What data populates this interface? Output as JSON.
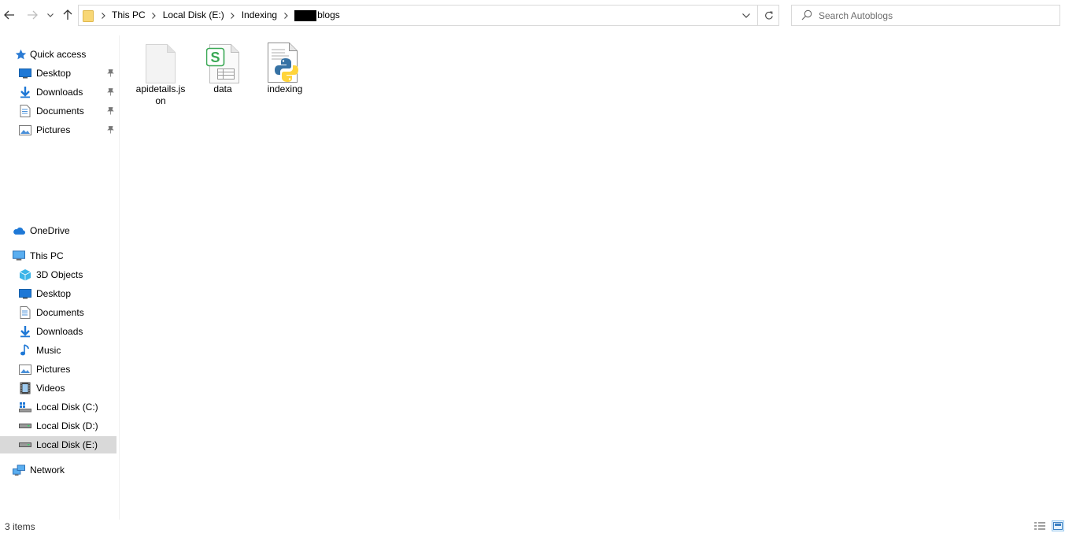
{
  "navigation": {
    "back_icon": "arrow-left-icon",
    "forward_icon": "arrow-right-icon",
    "recent_icon": "chevron-down-icon",
    "up_icon": "arrow-up-icon"
  },
  "address_bar": {
    "breadcrumbs": [
      "This PC",
      "Local Disk (E:)",
      "Indexing",
      "blogs"
    ],
    "current_folder_redacted": true
  },
  "search": {
    "placeholder": "Search Autoblogs"
  },
  "sidebar": {
    "quick_access": {
      "label": "Quick access",
      "items": [
        {
          "label": "Desktop",
          "icon": "desktop-icon",
          "pinned": true
        },
        {
          "label": "Downloads",
          "icon": "download-icon",
          "pinned": true
        },
        {
          "label": "Documents",
          "icon": "documents-icon",
          "pinned": true
        },
        {
          "label": "Pictures",
          "icon": "pictures-icon",
          "pinned": true
        }
      ]
    },
    "onedrive": {
      "label": "OneDrive"
    },
    "this_pc": {
      "label": "This PC",
      "items": [
        {
          "label": "3D Objects",
          "icon": "cube-icon"
        },
        {
          "label": "Desktop",
          "icon": "desktop-icon"
        },
        {
          "label": "Documents",
          "icon": "documents-icon"
        },
        {
          "label": "Downloads",
          "icon": "download-icon"
        },
        {
          "label": "Music",
          "icon": "music-note-icon"
        },
        {
          "label": "Pictures",
          "icon": "pictures-icon"
        },
        {
          "label": "Videos",
          "icon": "film-icon"
        },
        {
          "label": "Local Disk (C:)",
          "icon": "windows-drive-icon"
        },
        {
          "label": "Local Disk (D:)",
          "icon": "drive-icon"
        },
        {
          "label": "Local Disk (E:)",
          "icon": "drive-icon",
          "selected": true
        }
      ]
    },
    "network": {
      "label": "Network"
    }
  },
  "files": [
    {
      "name": "apidetails.json",
      "name_display": "apidetails.js on",
      "icon": "blank-file-icon"
    },
    {
      "name": "data",
      "name_display": "data",
      "icon": "spreadsheet-icon"
    },
    {
      "name": "indexing",
      "name_display": "indexing",
      "icon": "python-file-icon"
    }
  ],
  "status_bar": {
    "item_count": "3 items"
  },
  "colors": {
    "accent_blue": "#1e78d6",
    "selected_bg": "#d9d9d9",
    "border": "#d9d9d9",
    "folder_yellow": "#f8d775"
  }
}
